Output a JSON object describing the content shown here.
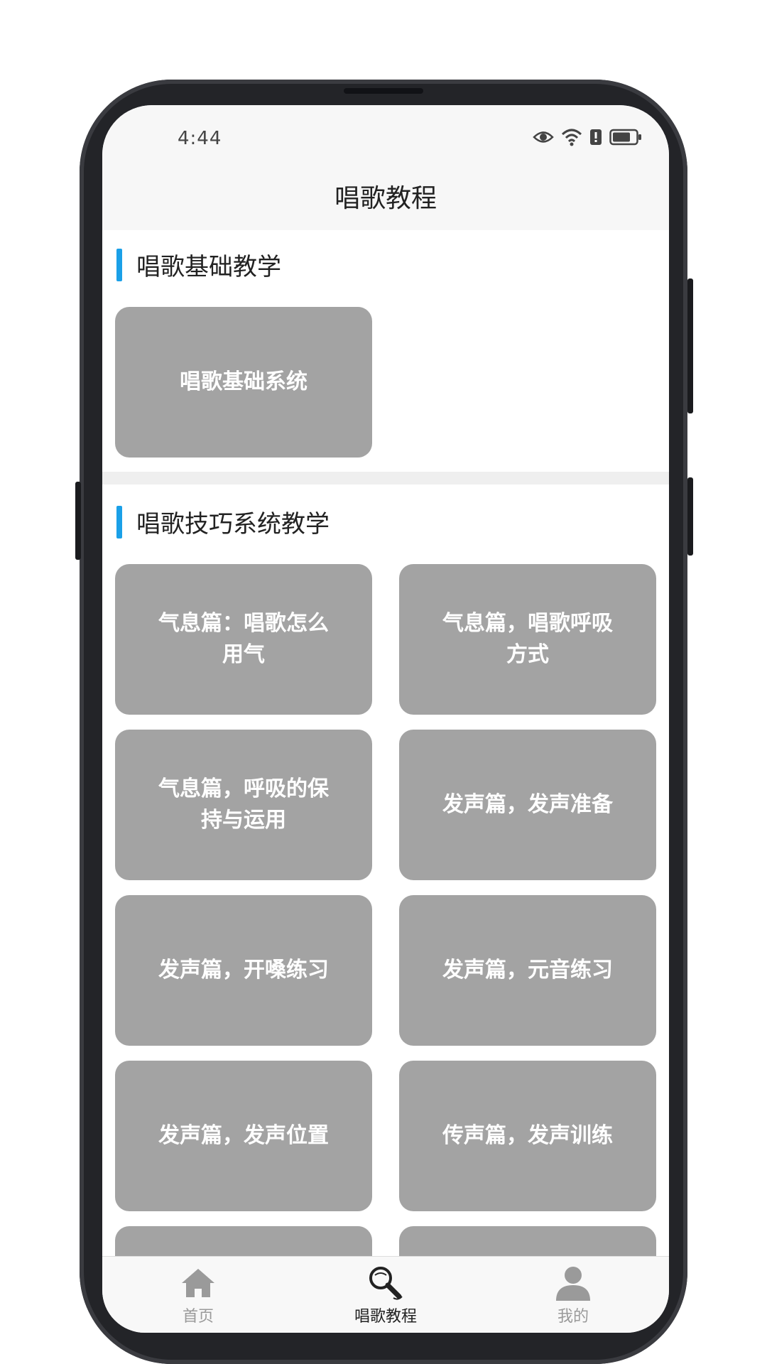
{
  "status_bar": {
    "time": "4:44",
    "icons": [
      "eye-icon",
      "wifi-icon",
      "alert-icon",
      "battery-icon"
    ]
  },
  "header": {
    "title": "唱歌教程"
  },
  "sections": [
    {
      "title": "唱歌基础教学",
      "cards": [
        {
          "label": "唱歌基础系统"
        }
      ]
    },
    {
      "title": "唱歌技巧系统教学",
      "cards": [
        {
          "label": "气息篇：唱歌怎么用气"
        },
        {
          "label": "气息篇，唱歌呼吸方式"
        },
        {
          "label": "气息篇，呼吸的保持与运用"
        },
        {
          "label": "发声篇，发声准备"
        },
        {
          "label": "发声篇，开嗓练习"
        },
        {
          "label": "发声篇，元音练习"
        },
        {
          "label": "发声篇，发声位置"
        },
        {
          "label": "传声篇，发声训练"
        }
      ]
    }
  ],
  "tabbar": {
    "items": [
      {
        "label": "首页",
        "icon": "home-icon",
        "active": false
      },
      {
        "label": "唱歌教程",
        "icon": "microphone-icon",
        "active": true
      },
      {
        "label": "我的",
        "icon": "person-icon",
        "active": false
      }
    ]
  },
  "colors": {
    "accent": "#1aa0e8",
    "card": "#a3a3a3",
    "frame": "#232428"
  }
}
